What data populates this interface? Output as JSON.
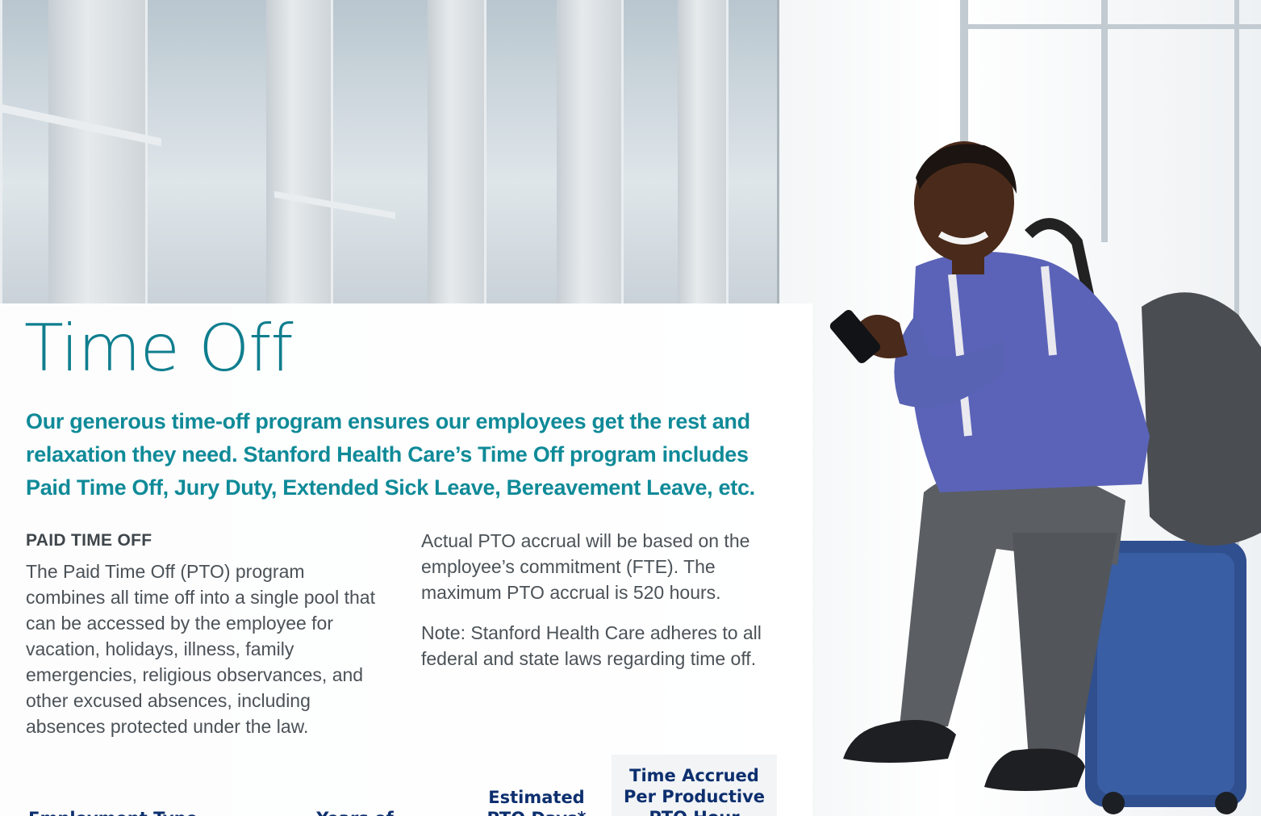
{
  "page": {
    "title": "Time Off",
    "intro": "Our generous time-off program ensures our employees get the rest and relaxation they need. Stanford Health Care’s Time Off program includes Paid Time Off, Jury Duty, Extended Sick Leave, Bereavement Leave, etc."
  },
  "pto": {
    "heading": "PAID TIME OFF",
    "para1": "The Paid Time Off (PTO) program combines all time off into a single pool that can be accessed by the employee for vacation, holidays, illness, family emergencies, religious observances, and other excused absences, including absences protected under the law.",
    "para2": "Actual PTO accrual will be based on the employee’s commitment (FTE). The maximum PTO accrual is 520 hours.",
    "para3": "Note: Stanford Health Care adheres to all federal and state laws regarding time off."
  },
  "table": {
    "headers": [
      "Employment Type",
      "Years of Service",
      "Estimated PTO Days*",
      "Time Accrued Per Productive PTO Hour"
    ]
  },
  "colors": {
    "title": "#0f7e8e",
    "intro": "#0f8a98",
    "table_header": "#0d2f6e",
    "shirt": "#5b63b8",
    "suitcase": "#2f4f8f"
  },
  "image": {
    "subject": "man-with-phone-on-suitcase"
  }
}
